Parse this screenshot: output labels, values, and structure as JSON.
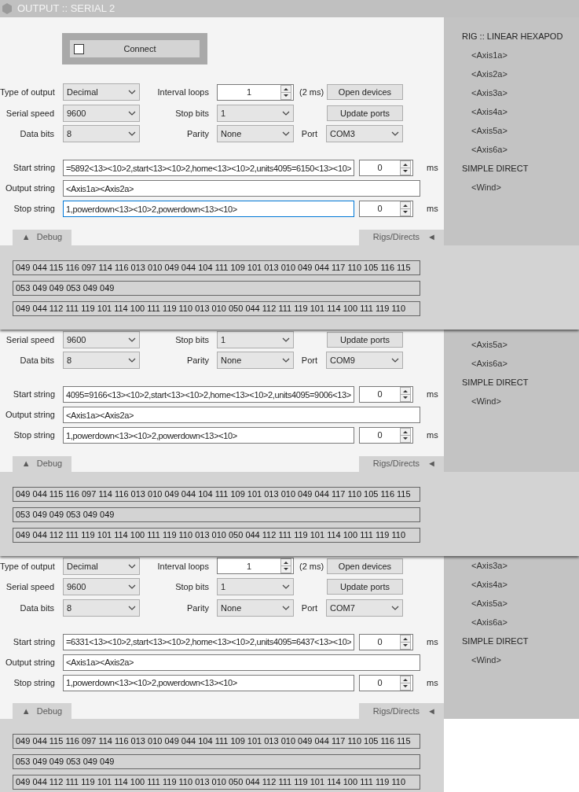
{
  "captures": [
    {
      "title": "OUTPUT :: SERIAL 2",
      "connect": {
        "label": "Connect",
        "checked": false
      },
      "rows": [
        {
          "left": [
            {
              "kind": "label",
              "text": "Type of output"
            },
            {
              "kind": "select",
              "value": "Decimal"
            }
          ],
          "middle": [
            {
              "kind": "label",
              "text": "Interval loops"
            },
            {
              "kind": "spin",
              "value": "1"
            }
          ],
          "right": [
            {
              "kind": "note",
              "text": "(2 ms)"
            },
            {
              "kind": "button",
              "text": "Open devices"
            }
          ]
        },
        {
          "left": [
            {
              "kind": "label",
              "text": "Serial speed"
            },
            {
              "kind": "select",
              "value": "9600"
            }
          ],
          "middle": [
            {
              "kind": "label",
              "text": "Stop bits"
            },
            {
              "kind": "select",
              "value": "1"
            }
          ],
          "right": [
            {
              "kind": "button",
              "text": "Update ports"
            }
          ]
        },
        {
          "left": [
            {
              "kind": "label",
              "text": "Data bits"
            },
            {
              "kind": "select",
              "value": "8"
            }
          ],
          "middle": [
            {
              "kind": "label",
              "text": "Parity"
            },
            {
              "kind": "select",
              "value": "None"
            }
          ],
          "right": [
            {
              "kind": "label",
              "text": "Port"
            },
            {
              "kind": "select",
              "value": "COM3"
            }
          ]
        }
      ],
      "strings": [
        {
          "label": "Start string",
          "value": "=5892<13><10>2,start<13><10>2,home<13><10>2,units4095=6150<13><10>",
          "focused": false,
          "delay": "0",
          "unit": "ms"
        },
        {
          "label": "Output string",
          "value": "<Axis1a><Axis2a>",
          "focused": false
        },
        {
          "label": "Stop string",
          "value": "1,powerdown<13><10>2,powerdown<13><10>",
          "focused": true,
          "delay": "0",
          "unit": "ms"
        }
      ],
      "debug_tab": {
        "icon": "▲",
        "label": "Debug"
      },
      "rigs_tab": {
        "label": "Rigs/Directs",
        "icon": "◄"
      },
      "debug": [
        "049 044 115 116 097 114 116 013 010 049 044 104 111 109 101 013 010 049 044 117 110 105 116 115",
        "053 049 049 053 049 049",
        "049 044 112 111 119 101 114 100 111 119 110 013 010 050 044 112 111 119 101 114 100 111 119 110"
      ],
      "sidebar": [
        {
          "kind": "heading",
          "text": "RIG :: LINEAR HEXAPOD"
        },
        {
          "kind": "item",
          "text": "<Axis1a>"
        },
        {
          "kind": "item",
          "text": "<Axis2a>"
        },
        {
          "kind": "item",
          "text": "<Axis3a>"
        },
        {
          "kind": "item",
          "text": "<Axis4a>"
        },
        {
          "kind": "item",
          "text": "<Axis5a>"
        },
        {
          "kind": "item",
          "text": "<Axis6a>"
        },
        {
          "kind": "heading",
          "text": "SIMPLE DIRECT"
        },
        {
          "kind": "item",
          "text": "<Wind>"
        }
      ]
    },
    {
      "rows": [
        {
          "left": [
            {
              "kind": "label",
              "text": "Serial speed"
            },
            {
              "kind": "select",
              "value": "9600"
            }
          ],
          "middle": [
            {
              "kind": "label",
              "text": "Stop bits"
            },
            {
              "kind": "select",
              "value": "1"
            }
          ],
          "right": [
            {
              "kind": "button",
              "text": "Update ports"
            }
          ]
        },
        {
          "left": [
            {
              "kind": "label",
              "text": "Data bits"
            },
            {
              "kind": "select",
              "value": "8"
            }
          ],
          "middle": [
            {
              "kind": "label",
              "text": "Parity"
            },
            {
              "kind": "select",
              "value": "None"
            }
          ],
          "right": [
            {
              "kind": "label",
              "text": "Port"
            },
            {
              "kind": "select",
              "value": "COM9"
            }
          ]
        }
      ],
      "strings": [
        {
          "label": "Start string",
          "value": "4095=9166<13><10>2,start<13><10>2,home<13><10>2,units4095=9006<13>",
          "focused": false,
          "delay": "0",
          "unit": "ms"
        },
        {
          "label": "Output string",
          "value": "<Axis1a><Axis2a>",
          "focused": false
        },
        {
          "label": "Stop string",
          "value": "1,powerdown<13><10>2,powerdown<13><10>",
          "focused": false,
          "delay": "0",
          "unit": "ms"
        }
      ],
      "debug_tab": {
        "icon": "▲",
        "label": "Debug"
      },
      "rigs_tab": {
        "label": "Rigs/Directs",
        "icon": "◄"
      },
      "debug": [
        "049 044 115 116 097 114 116 013 010 049 044 104 111 109 101 013 010 049 044 117 110 105 116 115",
        "053 049 049 053 049 049",
        "049 044 112 111 119 101 114 100 111 119 110 013 010 050 044 112 111 119 101 114 100 111 119 110"
      ],
      "sidebar": [
        {
          "kind": "item",
          "text": "<Axis5a>"
        },
        {
          "kind": "item",
          "text": "<Axis6a>"
        },
        {
          "kind": "heading",
          "text": "SIMPLE DIRECT"
        },
        {
          "kind": "item",
          "text": "<Wind>"
        }
      ]
    },
    {
      "rows": [
        {
          "left": [
            {
              "kind": "label",
              "text": "Type of output"
            },
            {
              "kind": "select",
              "value": "Decimal"
            }
          ],
          "middle": [
            {
              "kind": "label",
              "text": "Interval loops"
            },
            {
              "kind": "spin",
              "value": "1"
            }
          ],
          "right": [
            {
              "kind": "note",
              "text": "(2 ms)"
            },
            {
              "kind": "button",
              "text": "Open devices"
            }
          ]
        },
        {
          "left": [
            {
              "kind": "label",
              "text": "Serial speed"
            },
            {
              "kind": "select",
              "value": "9600"
            }
          ],
          "middle": [
            {
              "kind": "label",
              "text": "Stop bits"
            },
            {
              "kind": "select",
              "value": "1"
            }
          ],
          "right": [
            {
              "kind": "button",
              "text": "Update ports"
            }
          ]
        },
        {
          "left": [
            {
              "kind": "label",
              "text": "Data bits"
            },
            {
              "kind": "select",
              "value": "8"
            }
          ],
          "middle": [
            {
              "kind": "label",
              "text": "Parity"
            },
            {
              "kind": "select",
              "value": "None"
            }
          ],
          "right": [
            {
              "kind": "label",
              "text": "Port"
            },
            {
              "kind": "select",
              "value": "COM7"
            }
          ]
        }
      ],
      "strings": [
        {
          "label": "Start string",
          "value": "=6331<13><10>2,start<13><10>2,home<13><10>2,units4095=6437<13><10>",
          "focused": false,
          "delay": "0",
          "unit": "ms"
        },
        {
          "label": "Output string",
          "value": "<Axis1a><Axis2a>",
          "focused": false
        },
        {
          "label": "Stop string",
          "value": "1,powerdown<13><10>2,powerdown<13><10>",
          "focused": false,
          "delay": "0",
          "unit": "ms"
        }
      ],
      "debug_tab": {
        "icon": "▲",
        "label": "Debug"
      },
      "rigs_tab": {
        "label": "Rigs/Directs",
        "icon": "◄"
      },
      "debug": [
        "049 044 115 116 097 114 116 013 010 049 044 104 111 109 101 013 010 049 044 117 110 105 116 115",
        "053 049 049 053 049 049",
        "049 044 112 111 119 101 114 100 111 119 110 013 010 050 044 112 111 119 101 114 100 111 119 110"
      ],
      "sidebar": [
        {
          "kind": "item",
          "text": "<Axis3a>"
        },
        {
          "kind": "item",
          "text": "<Axis4a>"
        },
        {
          "kind": "item",
          "text": "<Axis5a>"
        },
        {
          "kind": "item",
          "text": "<Axis6a>"
        },
        {
          "kind": "heading",
          "text": "SIMPLE DIRECT"
        },
        {
          "kind": "item",
          "text": "<Wind>"
        }
      ]
    }
  ]
}
